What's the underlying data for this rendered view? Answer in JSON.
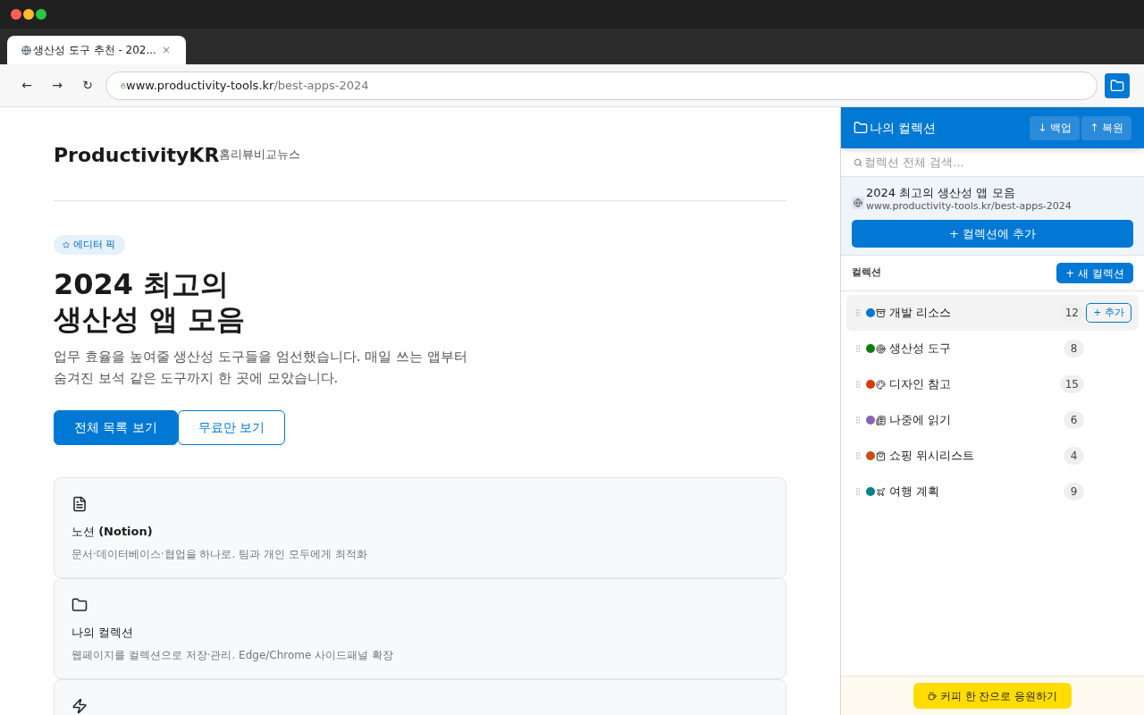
{
  "tab": {
    "title": "생산성 도구 추천 - 202...",
    "close": "×"
  },
  "nav": {
    "back": "←",
    "forward": "→",
    "reload": "↻",
    "url_host": "www.productivity-tools.kr",
    "url_path": "/best-apps-2024"
  },
  "site": {
    "logo": "ProductivityKR",
    "links": [
      "홈",
      "리뷰",
      "비교",
      "뉴스"
    ]
  },
  "hero": {
    "badge": "에디터 픽",
    "title_lines": [
      "2024 최고의",
      "생산성 앱 모음"
    ],
    "description_lines": [
      "업무 효율을 높여줄 생산성 도구들을 엄선했습니다. 매일 쓰는 앱부터",
      "숨겨진 보석 같은 도구까지 한 곳에 모았습니다."
    ],
    "buttons": [
      {
        "label": "전체 목록 보기",
        "kind": "primary"
      },
      {
        "label": "무료만 보기",
        "kind": "outline"
      }
    ]
  },
  "cards": [
    {
      "kind": "full",
      "title": "노션 **(Notion)**",
      "description": "문서·데이터베이스·협업을 하나로. 팀과 개인 모두에게 최적화"
    },
    {
      "kind": "full",
      "title": "나의 컬렉션",
      "description": "웹페이지를 컬렉션으로 저장·관리. Edge/Chrome 사이드패널 확장"
    },
    {
      "kind": "cut_off"
    }
  ],
  "panel": {
    "title": "나의 컬렉션",
    "header_buttons": [
      "↓ 백업",
      "↑ 복원"
    ],
    "search_placeholder": "컬렉션 전체 검색...",
    "current_page": {
      "title": "2024 최고의 생산성 앱 모음",
      "url": "www.productivity-tools.kr/best-apps-2024",
      "add_button": "+ 컬렉션에 추가"
    },
    "section_label": "컬렉션",
    "new_button": "+ 새 컬렉션",
    "collections": [
      {
        "name": "개발 리소스",
        "color": "#0078d4",
        "count": "12",
        "selected": true,
        "action": "+ 추가"
      },
      {
        "name": "생산성 도구",
        "color": "#107c10",
        "count": "8",
        "selected": false
      },
      {
        "name": "디자인 참고",
        "color": "#d83b01",
        "count": "15",
        "selected": false
      },
      {
        "name": "나중에 읽기",
        "color": "#8764b8",
        "count": "6",
        "selected": false
      },
      {
        "name": "쇼핑 위시리스트",
        "color": "#ca5010",
        "count": "4",
        "selected": false
      },
      {
        "name": "여행 계획",
        "color": "#038387",
        "count": "9",
        "selected": false
      }
    ],
    "support_button": "커피 한 잔으로 응원하기"
  }
}
